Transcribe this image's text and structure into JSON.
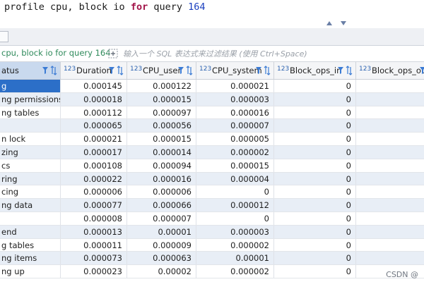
{
  "editor": {
    "parts": [
      {
        "t": "profile cpu, block io ",
        "k": "plain"
      },
      {
        "t": "for",
        "k": "kw"
      },
      {
        "t": " query ",
        "k": "plain"
      },
      {
        "t": "164",
        "k": "num"
      }
    ]
  },
  "filter": {
    "query_label": "cpu, block io for query 164",
    "placeholder": "输入一个 SQL 表达式来过滤结果 (使用 Ctrl+Space)"
  },
  "grid": {
    "columns": [
      {
        "type": "",
        "name": "atus"
      },
      {
        "type": "123",
        "name": "Duration"
      },
      {
        "type": "123",
        "name": "CPU_user"
      },
      {
        "type": "123",
        "name": "CPU_system"
      },
      {
        "type": "123",
        "name": "Block_ops_in"
      },
      {
        "type": "123",
        "name": "Block_ops_out"
      }
    ],
    "rows": [
      [
        "g",
        "0.000145",
        "0.000122",
        "0.000021",
        "0",
        ""
      ],
      [
        "ng permissions",
        "0.000018",
        "0.000015",
        "0.000003",
        "0",
        ""
      ],
      [
        "ng tables",
        "0.000112",
        "0.000097",
        "0.000016",
        "0",
        ""
      ],
      [
        "",
        "0.000065",
        "0.000056",
        "0.000007",
        "0",
        ""
      ],
      [
        "n lock",
        "0.000021",
        "0.000015",
        "0.000005",
        "0",
        ""
      ],
      [
        "zing",
        "0.000017",
        "0.000014",
        "0.000002",
        "0",
        ""
      ],
      [
        "cs",
        "0.000108",
        "0.000094",
        "0.000015",
        "0",
        ""
      ],
      [
        "ring",
        "0.000022",
        "0.000016",
        "0.000004",
        "0",
        ""
      ],
      [
        "cing",
        "0.000006",
        "0.000006",
        "0",
        "0",
        ""
      ],
      [
        "ng data",
        "0.000077",
        "0.000066",
        "0.000012",
        "0",
        ""
      ],
      [
        "",
        "0.000008",
        "0.000007",
        "0",
        "0",
        ""
      ],
      [
        "end",
        "0.000013",
        "0.00001",
        "0.000003",
        "0",
        ""
      ],
      [
        "g tables",
        "0.000011",
        "0.000009",
        "0.000002",
        "0",
        ""
      ],
      [
        "ng items",
        "0.000073",
        "0.000063",
        "0.00001",
        "0",
        ""
      ],
      [
        "ng up",
        "0.000023",
        "0.00002",
        "0.000002",
        "0",
        ""
      ]
    ],
    "selected_row": 0
  },
  "watermark": "CSDN @",
  "colors": {
    "accent": "#2c6fc8",
    "keyword": "#a3154a",
    "number": "#1a3fbf",
    "filter_text": "#2f8a5b",
    "row_alt": "#e8eef6"
  },
  "icons": [
    "collapse-arrows-icon",
    "filter-icon",
    "sort-icon",
    "expand-filter-icon",
    "pane-toggle-icon"
  ]
}
